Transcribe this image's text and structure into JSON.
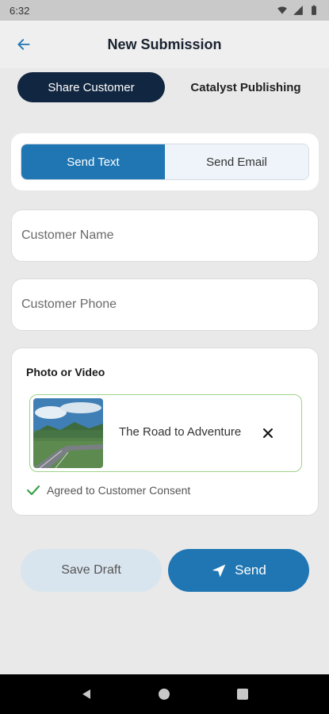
{
  "status": {
    "time": "6:32"
  },
  "header": {
    "title": "New Submission"
  },
  "top_tabs": [
    {
      "label": "Share Customer",
      "active": true
    },
    {
      "label": "Catalyst Publishing",
      "active": false
    }
  ],
  "send_toggle": [
    {
      "label": "Send Text",
      "active": true
    },
    {
      "label": "Send Email",
      "active": false
    }
  ],
  "fields": {
    "name_placeholder": "Customer Name",
    "phone_placeholder": "Customer Phone"
  },
  "media": {
    "section_label": "Photo or Video",
    "item_title": "The Road to Adventure",
    "consent_text": "Agreed to Customer Consent"
  },
  "actions": {
    "draft_label": "Save Draft",
    "send_label": "Send"
  },
  "colors": {
    "primary": "#1f76b3",
    "dark_navy": "#112640",
    "consent_green": "#3aa24a"
  }
}
